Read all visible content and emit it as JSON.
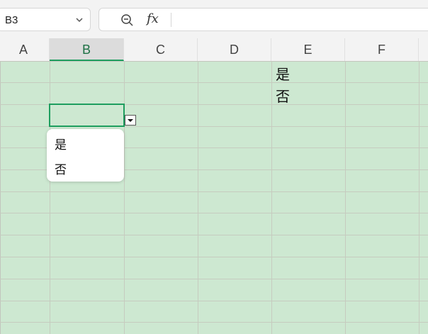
{
  "name_box": {
    "value": "B3"
  },
  "formula_bar": {
    "fx_label": "fx",
    "content": ""
  },
  "columns": [
    "A",
    "B",
    "C",
    "D",
    "E",
    "F"
  ],
  "selected_column": "B",
  "cells": {
    "E1": "是",
    "E2": "否"
  },
  "dropdown": {
    "options": [
      "是",
      "否"
    ]
  },
  "colors": {
    "grid_background": "#cde8d1",
    "selection": "#1e9e5f"
  }
}
